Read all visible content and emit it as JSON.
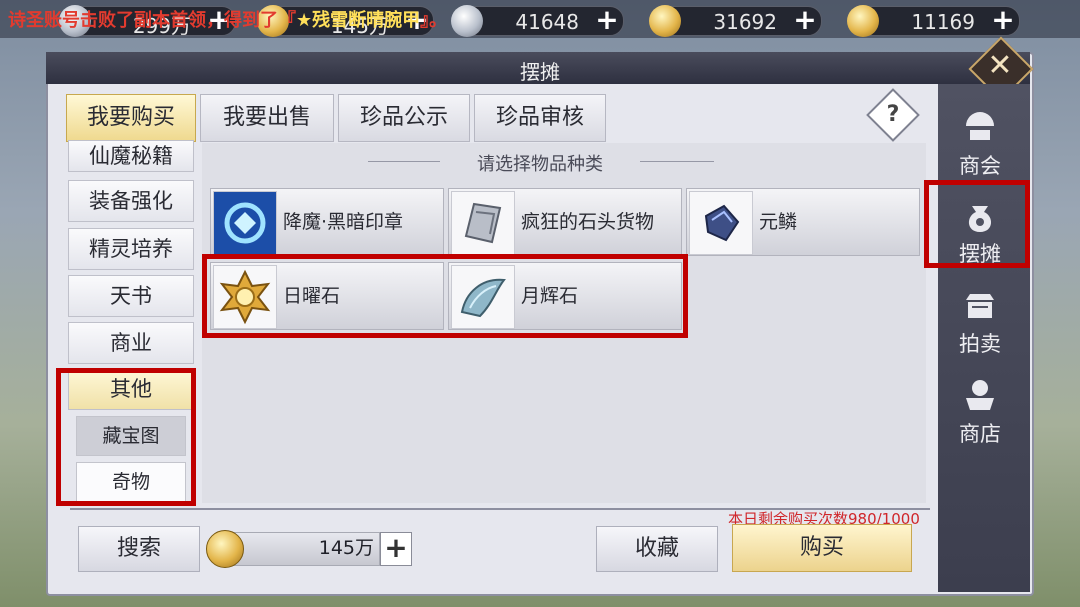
{
  "broadcast": {
    "text": "诗圣账号击败了副本首领，得到了『",
    "item": "★残雪断晴腕甲",
    "end": "』。"
  },
  "currencies": [
    {
      "name": "silver-coin",
      "value": "299万"
    },
    {
      "name": "gold-coin",
      "value": "145万"
    },
    {
      "name": "silver-ingot",
      "value": "41648"
    },
    {
      "name": "gold-ingot",
      "value": "31692"
    },
    {
      "name": "gold-ingot-2",
      "value": "11169"
    }
  ],
  "window": {
    "title": "摆摊",
    "close_icon": "close-icon"
  },
  "tabs": [
    {
      "label": "我要购买",
      "active": true
    },
    {
      "label": "我要出售",
      "active": false
    },
    {
      "label": "珍品公示",
      "active": false
    },
    {
      "label": "珍品审核",
      "active": false
    }
  ],
  "help": "?",
  "categories": [
    {
      "label": "仙魔秘籍"
    },
    {
      "label": "装备强化"
    },
    {
      "label": "精灵培养"
    },
    {
      "label": "天书"
    },
    {
      "label": "商业"
    },
    {
      "label": "其他",
      "active": true
    }
  ],
  "subcategories": [
    {
      "label": "藏宝图",
      "selected": true
    },
    {
      "label": "奇物",
      "selected": false
    }
  ],
  "items_hint": "请选择物品种类",
  "items": [
    {
      "name": "降魔·黑暗印章",
      "icon": "dark-seal-icon"
    },
    {
      "name": "疯狂的石头货物",
      "icon": "stone-goods-icon"
    },
    {
      "name": "元鳞",
      "icon": "scale-icon"
    },
    {
      "name": "日曜石",
      "icon": "sun-stone-icon"
    },
    {
      "name": "月辉石",
      "icon": "moon-stone-icon"
    }
  ],
  "bottom": {
    "remaining_label": "本日剩余购买次数980/1000",
    "search_button": "搜索",
    "money": "145万",
    "plus": "+",
    "favorite_button": "收藏",
    "buy_button": "购买"
  },
  "sidenav": [
    {
      "label": "商会",
      "icon": "guild-icon"
    },
    {
      "label": "摆摊",
      "icon": "stall-bag-icon",
      "active": true
    },
    {
      "label": "拍卖",
      "icon": "auction-icon"
    },
    {
      "label": "商店",
      "icon": "shop-icon"
    }
  ],
  "colors": {
    "highlight": "#c00000",
    "accent_gold": "#efd98e",
    "warning_red": "#d0262a"
  }
}
